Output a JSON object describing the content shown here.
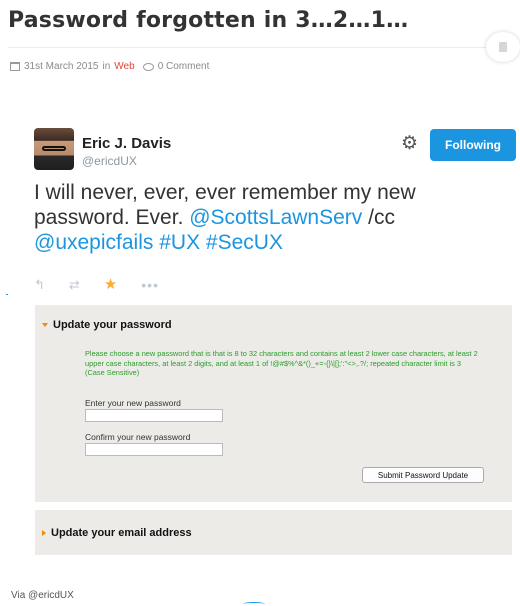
{
  "post": {
    "title": "Password forgotten in 3…2…1…",
    "date": "31st March 2015",
    "in_label": "in",
    "category": "Web",
    "comments": "0 Comment"
  },
  "tweet": {
    "name": "Eric J. Davis",
    "handle": "@ericdUX",
    "follow_label": "Following",
    "text_1": "I will never, ever, ever remember my new password. Ever. ",
    "mention_1": "@ScottsLawnServ",
    "text_2": " /cc ",
    "mention_2": "@uxepicfails",
    "text_3": " ",
    "hashtag_1": "#UX",
    "text_4": " ",
    "hashtag_2": "#SecUX",
    "icons": [
      "reply-icon",
      "retweet-icon",
      "favorite-star-icon",
      "more-icon"
    ]
  },
  "form": {
    "section_title": "Update your password",
    "rules_1": "Please choose a new password that is that is 8 to 32 characters and contains at least 2 lower case characters, at least 2 upper case characters, at least 2 digits, and at least 1 of !@#$%^&*()_+=-{}\\|[];':\"<>,.?/; repeated character limit is 3",
    "rules_2": "(Case Sensitive)",
    "new_pw_label": "Enter your new password",
    "new_pw_value": "",
    "confirm_pw_label": "Confirm your new password",
    "confirm_pw_value": "",
    "submit_label": "Submit Password Update",
    "email_section_title": "Update your email address"
  },
  "via": "Via @ericdUX",
  "colors": {
    "link": "#1b95e0",
    "category": "#e0453a",
    "rules_green": "#2a9d2a",
    "accent_orange": "#f08c00",
    "panel_bg": "#ecebe7",
    "star": "#ffac33"
  }
}
